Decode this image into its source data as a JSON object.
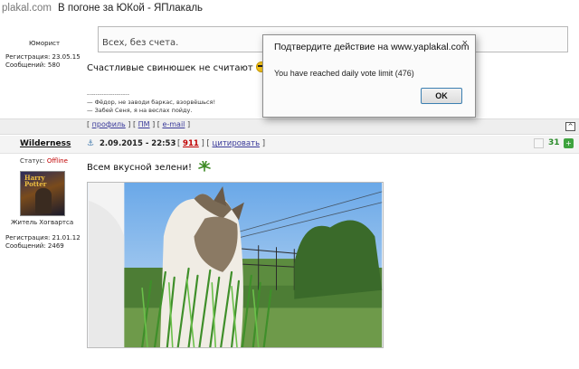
{
  "browser": {
    "site": "plakal.com",
    "title": "В погоне за ЮКой - ЯПлакаль"
  },
  "post1": {
    "user_rank": "Юморист",
    "reg_label": "Регистрация: 23.05.15",
    "posts_label": "Сообщений: 580",
    "quote_text": "Всех, без счета.",
    "text": "Счастливые свинюшек не считают",
    "sig_dashes": "--------------------",
    "sig_line1": "— Фёдор, не заводи баркас, взорвёшься!",
    "sig_line2": "— Забей Сеня, я на веслах пойду.",
    "actions": {
      "open1": "[",
      "profile": "профиль",
      "sep1": "] [",
      "pm": "ПМ",
      "sep2": "] [",
      "email": "e-mail",
      "close1": "]"
    }
  },
  "post2": {
    "username": "Wilderness",
    "status_label": "Статус:",
    "status_value": "Offline",
    "avatar_text": "Harry Potter",
    "user_title": "Житель Хогвартса",
    "reg_label": "Регистрация: 21.01.12",
    "posts_label": "Сообщений: 2469",
    "date": "2.09.2015 - 22:53",
    "num_open": "[",
    "num": "911",
    "num_close": "] [",
    "quote_link": "цитировать",
    "quote_close": "]",
    "score": "31",
    "text": "Всем вкусной зелени!"
  },
  "dialog": {
    "title": "Подтвердите действие на www.yaplakal.com",
    "message": "You have reached daily vote limit (476)",
    "ok_label": "OK",
    "close_glyph": "×"
  },
  "icons": {
    "anchor": "⚓",
    "up": "^",
    "plus": "+"
  },
  "colors": {
    "offline": "#c00000",
    "post_number": "#c00000",
    "score": "#2a8a2a",
    "link": "#3a3a9a"
  }
}
